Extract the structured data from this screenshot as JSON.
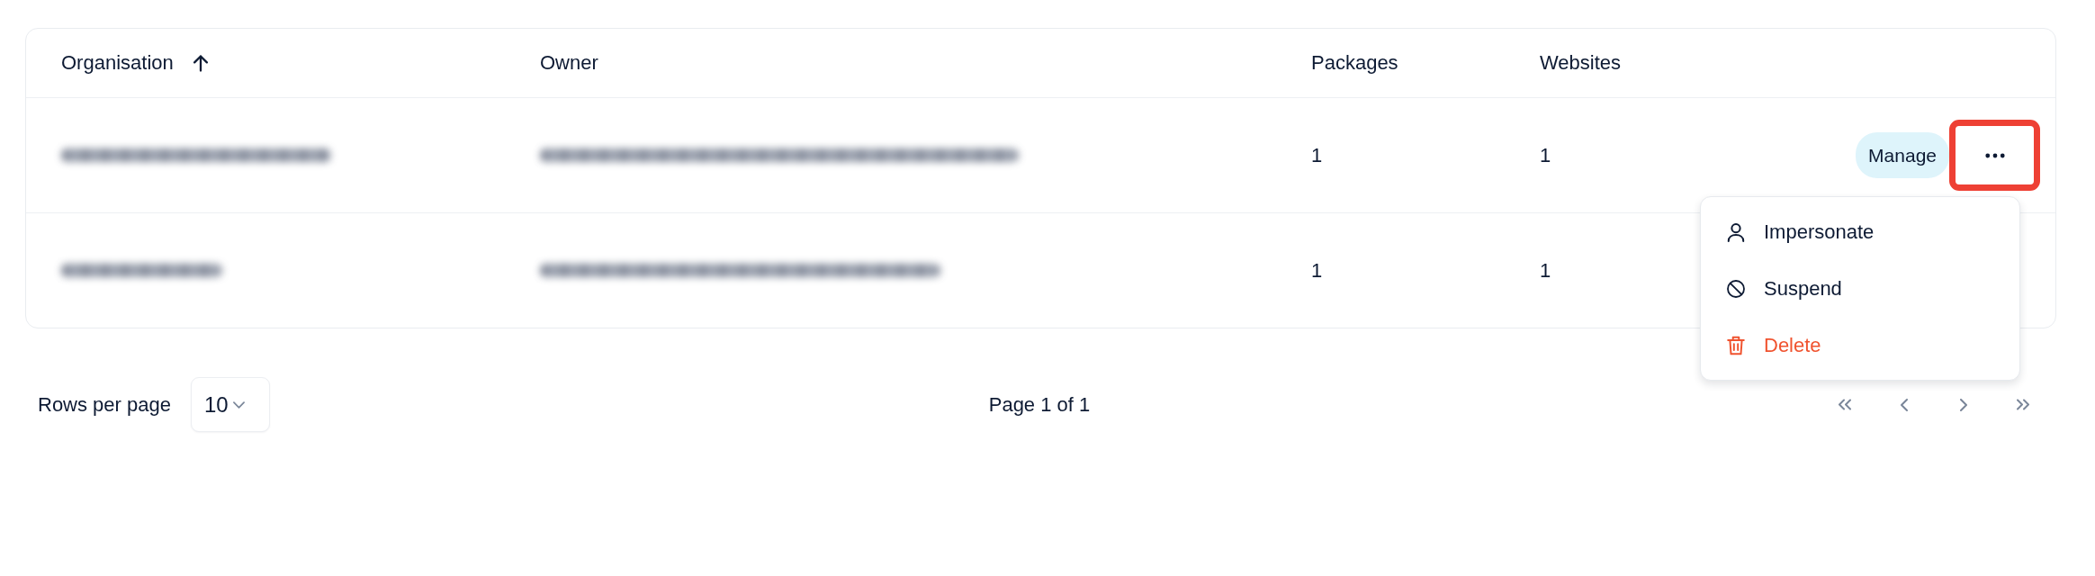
{
  "table": {
    "columns": [
      {
        "label": "Organisation",
        "sorted": true
      },
      {
        "label": "Owner",
        "sorted": false
      },
      {
        "label": "Packages",
        "sorted": false
      },
      {
        "label": "Websites",
        "sorted": false
      }
    ],
    "rows": [
      {
        "organisation_blurred": true,
        "owner_blurred": true,
        "packages": "1",
        "websites": "1",
        "actions": {
          "manage": "Manage",
          "more_highlighted": true,
          "more_expanded": true,
          "menu": [
            {
              "kind": "impersonate",
              "label": "Impersonate",
              "danger": false
            },
            {
              "kind": "suspend",
              "label": "Suspend",
              "danger": false
            },
            {
              "kind": "delete",
              "label": "Delete",
              "danger": true
            }
          ]
        }
      },
      {
        "organisation_blurred": true,
        "owner_blurred": true,
        "packages": "1",
        "websites": "1"
      }
    ]
  },
  "pagination": {
    "rows_per_page_label": "Rows per page",
    "rows_per_page_value": "10",
    "page_text": "Page 1 of 1",
    "buttons": [
      {
        "kind": "first",
        "disabled": true
      },
      {
        "kind": "previous",
        "disabled": true
      },
      {
        "kind": "next",
        "disabled": true
      },
      {
        "kind": "last",
        "disabled": true
      }
    ]
  }
}
